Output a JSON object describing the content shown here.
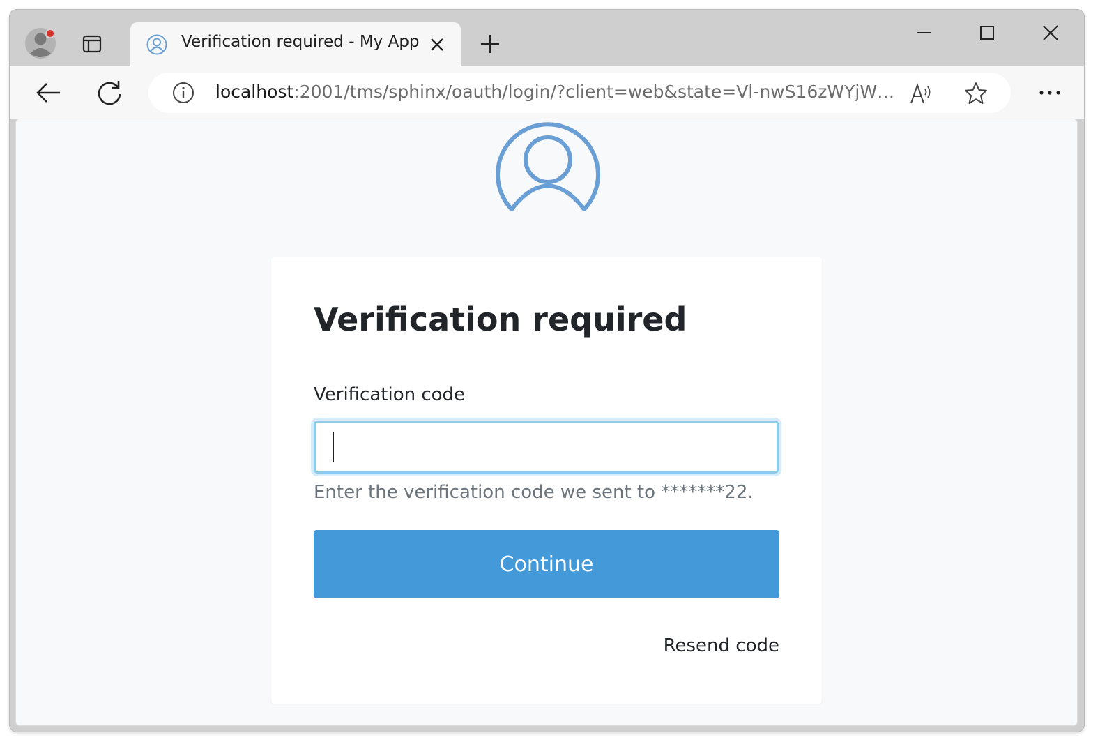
{
  "browser": {
    "tab": {
      "title": "Verification required - My App"
    },
    "address": {
      "host": "localhost",
      "path": ":2001/tms/sphinx/oauth/login/?client=web&state=Vl-nwS16zWYjW2..."
    },
    "icons": {
      "profile": "profile-avatar-icon",
      "tab_actions": "tab-actions-icon",
      "tab_favicon": "user-circle-icon",
      "tab_close": "close-icon",
      "new_tab": "plus-icon",
      "minimize": "minimize-icon",
      "maximize": "maximize-icon",
      "close_window": "close-icon",
      "back": "back-arrow-icon",
      "refresh": "refresh-icon",
      "site_info": "info-icon",
      "read_aloud": "read-aloud-icon",
      "favorite": "star-icon",
      "more": "more-icon"
    }
  },
  "page": {
    "avatar_icon": "user-circle-icon",
    "title": "Verification required",
    "field_label": "Verification code",
    "code_value": "",
    "help_text": "Enter the verification code we sent to *******22.",
    "continue_label": "Continue",
    "resend_label": "Resend code"
  },
  "colors": {
    "accent": "#4499d8",
    "avatar": "#6a9fd6",
    "input_focus": "#8ec9ee",
    "profile_notification": "#d9322b"
  }
}
